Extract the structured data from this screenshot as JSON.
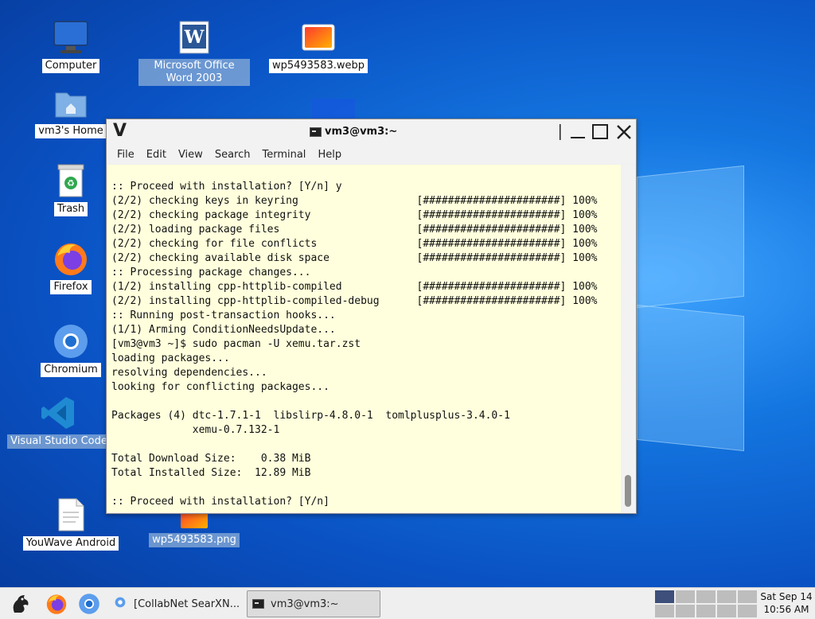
{
  "desktop": {
    "icons": [
      {
        "label": "Computer"
      },
      {
        "label": "Microsoft Office Word 2003"
      },
      {
        "label": "wp5493583.webp"
      },
      {
        "label": "vm3's Home"
      },
      {
        "label": "Trash"
      },
      {
        "label": "Firefox"
      },
      {
        "label": "Chromium"
      },
      {
        "label": "Visual Studio Code"
      },
      {
        "label": "YouWave Android"
      },
      {
        "label": "wp5493583.png"
      }
    ]
  },
  "terminal": {
    "title": "vm3@vm3:~",
    "menu": [
      "File",
      "Edit",
      "View",
      "Search",
      "Terminal",
      "Help"
    ],
    "lines": [
      ":: Proceed with installation? [Y/n] y",
      "(2/2) checking keys in keyring                   [######################] 100%",
      "(2/2) checking package integrity                 [######################] 100%",
      "(2/2) loading package files                      [######################] 100%",
      "(2/2) checking for file conflicts                [######################] 100%",
      "(2/2) checking available disk space              [######################] 100%",
      ":: Processing package changes...",
      "(1/2) installing cpp-httplib-compiled            [######################] 100%",
      "(2/2) installing cpp-httplib-compiled-debug      [######################] 100%",
      ":: Running post-transaction hooks...",
      "(1/1) Arming ConditionNeedsUpdate...",
      "[vm3@vm3 ~]$ sudo pacman -U xemu.tar.zst",
      "loading packages...",
      "resolving dependencies...",
      "looking for conflicting packages...",
      "",
      "Packages (4) dtc-1.7.1-1  libslirp-4.8.0-1  tomlplusplus-3.4.0-1",
      "             xemu-0.7.132-1",
      "",
      "Total Download Size:    0.38 MiB",
      "Total Installed Size:  12.89 MiB",
      "",
      ":: Proceed with installation? [Y/n]"
    ]
  },
  "taskbar": {
    "tasks": [
      {
        "label": "[CollabNet SearXN..."
      },
      {
        "label": "vm3@vm3:~"
      }
    ],
    "clock": {
      "date": "Sat Sep 14",
      "time": "10:56 AM"
    }
  }
}
